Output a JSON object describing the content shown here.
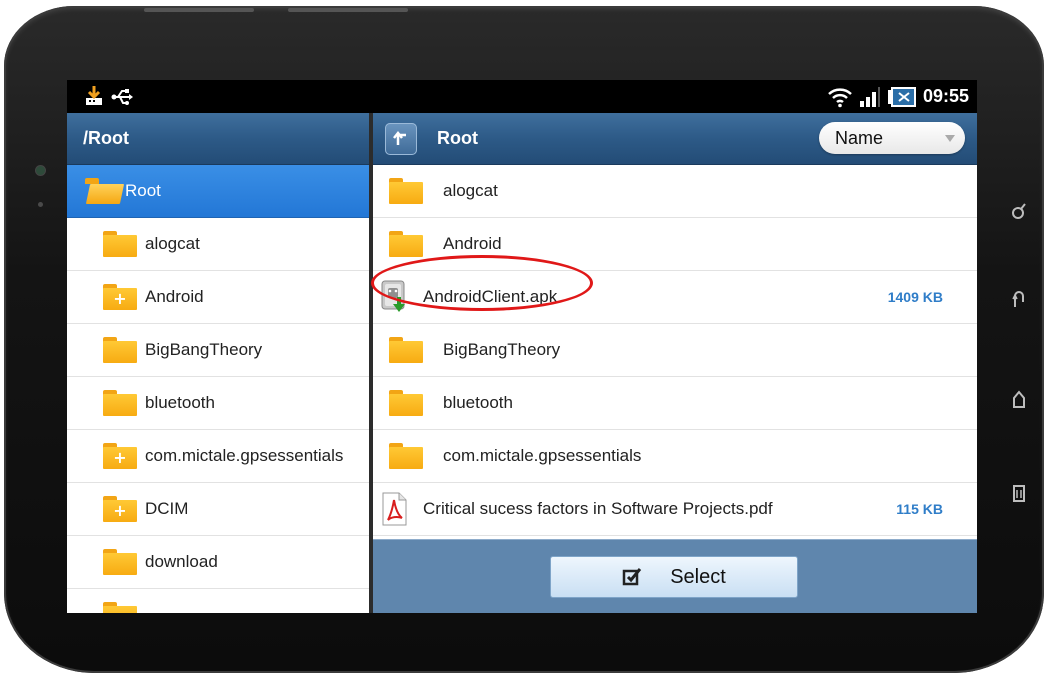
{
  "status_bar": {
    "time": "09:55",
    "icons": [
      "usb-storage-icon",
      "usb-debug-icon",
      "wifi-icon",
      "signal-icon",
      "battery-icon"
    ]
  },
  "left_pane": {
    "path": "/Root",
    "items": [
      {
        "label": "Root",
        "icon": "folder-open-icon",
        "selected": true,
        "expandable": false
      },
      {
        "label": "alogcat",
        "icon": "folder-icon",
        "selected": false,
        "expandable": false
      },
      {
        "label": "Android",
        "icon": "folder-plus-icon",
        "selected": false,
        "expandable": true
      },
      {
        "label": "BigBangTheory",
        "icon": "folder-icon",
        "selected": false,
        "expandable": false
      },
      {
        "label": "bluetooth",
        "icon": "folder-icon",
        "selected": false,
        "expandable": false
      },
      {
        "label": "com.mictale.gpsessentials",
        "icon": "folder-plus-icon",
        "selected": false,
        "expandable": true
      },
      {
        "label": "DCIM",
        "icon": "folder-plus-icon",
        "selected": false,
        "expandable": true
      },
      {
        "label": "download",
        "icon": "folder-icon",
        "selected": false,
        "expandable": false
      }
    ]
  },
  "right_pane": {
    "title": "Root",
    "sort": {
      "selected": "Name"
    },
    "items": [
      {
        "label": "alogcat",
        "type": "folder",
        "size": ""
      },
      {
        "label": "Android",
        "type": "folder",
        "size": ""
      },
      {
        "label": "AndroidClient.apk",
        "type": "apk",
        "size": "1409 KB",
        "highlighted": true
      },
      {
        "label": "BigBangTheory",
        "type": "folder",
        "size": ""
      },
      {
        "label": "bluetooth",
        "type": "folder",
        "size": ""
      },
      {
        "label": "com.mictale.gpsessentials",
        "type": "folder",
        "size": ""
      },
      {
        "label": "Critical sucess factors in Software Projects.pdf",
        "type": "pdf",
        "size": "115 KB"
      }
    ],
    "select_button": "Select"
  },
  "colors": {
    "header_blue": "#2d5a87",
    "selection_blue": "#2377d6",
    "size_blue": "#2f7dc8",
    "folder_yellow": "#f7ab12",
    "highlight_red": "#e01818"
  }
}
